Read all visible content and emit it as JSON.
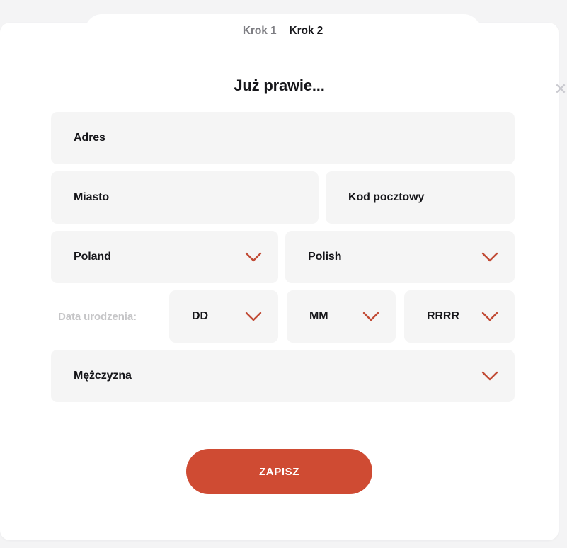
{
  "modal": {
    "close_icon": "close-icon",
    "steps": [
      {
        "label": "Krok 1",
        "active": false
      },
      {
        "label": "Krok 2",
        "active": true
      }
    ],
    "title": "Już prawie..."
  },
  "form": {
    "address": {
      "value": "Adres",
      "placeholder": "Adres"
    },
    "city": {
      "value": "Miasto",
      "placeholder": "Miasto"
    },
    "postal_code": {
      "value": "Kod pocztowy",
      "placeholder": "Kod pocztowy"
    },
    "country": {
      "value": "Poland",
      "icon": "chevron-down-icon"
    },
    "language": {
      "value": "Polish",
      "icon": "chevron-down-icon"
    },
    "date_of_birth": {
      "label": "Data urodzenia:",
      "day": {
        "value": "DD",
        "icon": "chevron-down-icon"
      },
      "month": {
        "value": "MM",
        "icon": "chevron-down-icon"
      },
      "year": {
        "value": "RRRR",
        "icon": "chevron-down-icon"
      }
    },
    "gender": {
      "value": "Mężczyzna",
      "icon": "chevron-down-icon"
    }
  },
  "actions": {
    "save_label": "ZAPISZ"
  },
  "colors": {
    "accent": "#cf4b33",
    "page_background": "#f4f4f5",
    "modal_background": "#ffffff",
    "field_background": "#f5f5f5",
    "text_primary": "#16161a",
    "text_muted": "#7e7e83",
    "label_muted": "#c6c6c8"
  }
}
